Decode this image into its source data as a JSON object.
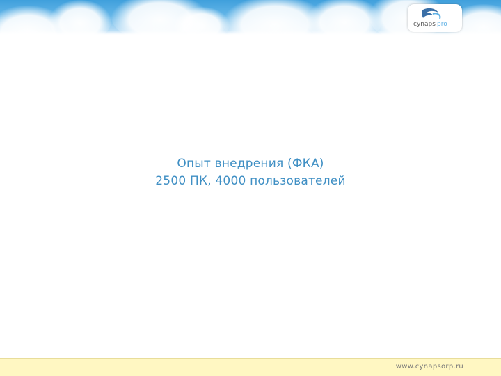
{
  "banner": {
    "logo": {
      "icon": "cynapspro-logo",
      "colors": {
        "swoosh": "#3a6fa6",
        "text": "#555555",
        "accent": "#5fb1e5"
      }
    }
  },
  "slide": {
    "line1": "Опыт внедрения (ФКА)",
    "line2": "2500 ПК, 4000 пользователей"
  },
  "footer": {
    "url": "www.cynapsorp.ru"
  },
  "colors": {
    "text": "#3f8fc4",
    "footer_bg": "#fff7c2",
    "sky": "#64b6e8"
  }
}
